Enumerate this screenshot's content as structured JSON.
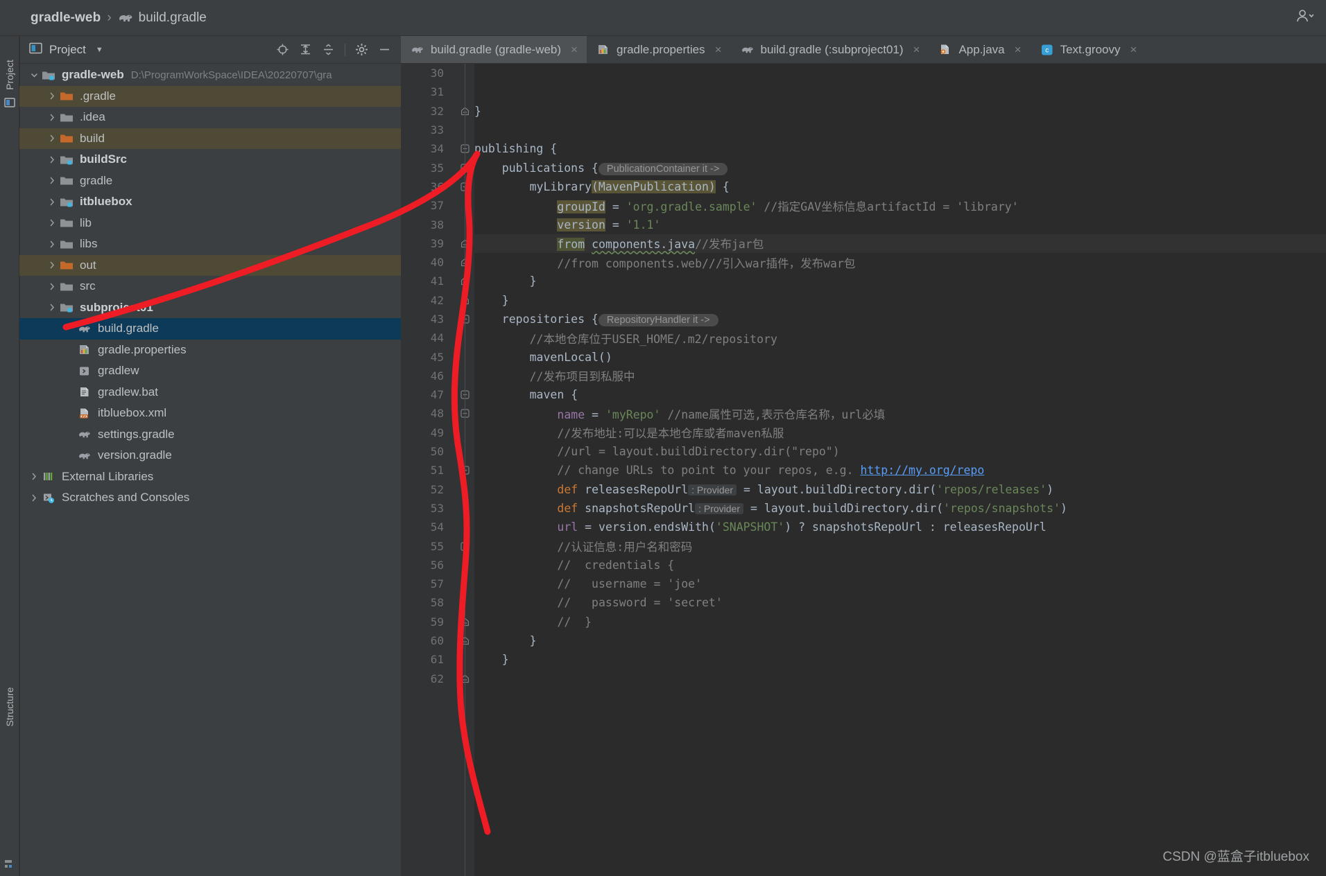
{
  "window": {
    "breadcrumb_project": "gradle-web",
    "breadcrumb_separator": "›",
    "breadcrumb_file": "build.gradle",
    "accent_selection": "#0d3a58",
    "accent_highlight": "#4f4a36",
    "annotation_color": "#ee1c25"
  },
  "left_strip": {
    "top_label": "Project",
    "bottom_label": "Structure"
  },
  "project_panel": {
    "title": "Project",
    "caret": "▼",
    "tools": [
      {
        "name": "locate-icon",
        "label": "Select Opened File"
      },
      {
        "name": "expand-all-icon",
        "label": "Expand All"
      },
      {
        "name": "collapse-all-icon",
        "label": "Collapse All"
      },
      {
        "name": "gear-icon",
        "label": "Settings"
      },
      {
        "name": "minimize-icon",
        "label": "Hide"
      }
    ],
    "tree": [
      {
        "label": "gradle-web",
        "path": "D:\\ProgramWorkSpace\\IDEA\\20220707\\gra",
        "indent": 0,
        "arrow": "down",
        "icon": "module-folder",
        "bold": true,
        "state": "normal"
      },
      {
        "label": ".gradle",
        "path": "",
        "indent": 1,
        "arrow": "right",
        "icon": "folder-orange",
        "bold": false,
        "state": "excluded"
      },
      {
        "label": ".idea",
        "path": "",
        "indent": 1,
        "arrow": "right",
        "icon": "folder-grey",
        "bold": false,
        "state": "normal"
      },
      {
        "label": "build",
        "path": "",
        "indent": 1,
        "arrow": "right",
        "icon": "folder-orange",
        "bold": false,
        "state": "excluded"
      },
      {
        "label": "buildSrc",
        "path": "",
        "indent": 1,
        "arrow": "right",
        "icon": "module-folder",
        "bold": true,
        "state": "normal"
      },
      {
        "label": "gradle",
        "path": "",
        "indent": 1,
        "arrow": "right",
        "icon": "folder-grey",
        "bold": false,
        "state": "normal"
      },
      {
        "label": "itbluebox",
        "path": "",
        "indent": 1,
        "arrow": "right",
        "icon": "module-folder",
        "bold": true,
        "state": "normal"
      },
      {
        "label": "lib",
        "path": "",
        "indent": 1,
        "arrow": "right",
        "icon": "folder-grey",
        "bold": false,
        "state": "normal"
      },
      {
        "label": "libs",
        "path": "",
        "indent": 1,
        "arrow": "right",
        "icon": "folder-grey",
        "bold": false,
        "state": "normal"
      },
      {
        "label": "out",
        "path": "",
        "indent": 1,
        "arrow": "right",
        "icon": "folder-orange",
        "bold": false,
        "state": "excluded"
      },
      {
        "label": "src",
        "path": "",
        "indent": 1,
        "arrow": "right",
        "icon": "folder-grey",
        "bold": false,
        "state": "normal"
      },
      {
        "label": "subproject01",
        "path": "",
        "indent": 1,
        "arrow": "right",
        "icon": "module-folder",
        "bold": true,
        "state": "normal"
      },
      {
        "label": "build.gradle",
        "path": "",
        "indent": 2,
        "arrow": "none",
        "icon": "gradle-file",
        "bold": false,
        "state": "selected"
      },
      {
        "label": "gradle.properties",
        "path": "",
        "indent": 2,
        "arrow": "none",
        "icon": "properties-file",
        "bold": false,
        "state": "normal"
      },
      {
        "label": "gradlew",
        "path": "",
        "indent": 2,
        "arrow": "none",
        "icon": "script-file",
        "bold": false,
        "state": "normal"
      },
      {
        "label": "gradlew.bat",
        "path": "",
        "indent": 2,
        "arrow": "none",
        "icon": "bat-file",
        "bold": false,
        "state": "normal"
      },
      {
        "label": "itbluebox.xml",
        "path": "",
        "indent": 2,
        "arrow": "none",
        "icon": "xml-file",
        "bold": false,
        "state": "normal"
      },
      {
        "label": "settings.gradle",
        "path": "",
        "indent": 2,
        "arrow": "none",
        "icon": "gradle-file",
        "bold": false,
        "state": "normal"
      },
      {
        "label": "version.gradle",
        "path": "",
        "indent": 2,
        "arrow": "none",
        "icon": "gradle-file",
        "bold": false,
        "state": "normal"
      },
      {
        "label": "External Libraries",
        "path": "",
        "indent": 0,
        "arrow": "right",
        "icon": "libraries",
        "bold": false,
        "state": "normal"
      },
      {
        "label": "Scratches and Consoles",
        "path": "",
        "indent": 0,
        "arrow": "right",
        "icon": "scratches",
        "bold": false,
        "state": "normal"
      }
    ]
  },
  "editor": {
    "tabs": [
      {
        "label": "build.gradle (gradle-web)",
        "icon": "gradle-file",
        "active": true,
        "close": "×"
      },
      {
        "label": "gradle.properties",
        "icon": "properties-file",
        "active": false,
        "close": "×"
      },
      {
        "label": "build.gradle (:subproject01)",
        "icon": "gradle-file",
        "active": false,
        "close": "×"
      },
      {
        "label": "App.java",
        "icon": "java-file",
        "active": false,
        "close": "×"
      },
      {
        "label": "Text.groovy",
        "icon": "groovy-file",
        "active": false,
        "close": "×"
      }
    ],
    "first_line_number": 30,
    "current_line": 39,
    "lines": [
      {
        "n": 30,
        "fold": "",
        "tokens": []
      },
      {
        "n": 31,
        "fold": "",
        "tokens": []
      },
      {
        "n": 32,
        "fold": "end",
        "tokens": [
          {
            "t": "}",
            "c": "brace",
            "indent": 0
          }
        ]
      },
      {
        "n": 33,
        "fold": "",
        "tokens": []
      },
      {
        "n": 34,
        "fold": "start",
        "tokens": [
          {
            "t": "publishing {",
            "c": "plain",
            "indent": 0
          }
        ]
      },
      {
        "n": 35,
        "fold": "start",
        "tokens": [
          {
            "t": "publications {",
            "c": "plain",
            "indent": 4
          },
          {
            "t": "PublicationContainer it ->",
            "c": "hint"
          }
        ]
      },
      {
        "n": 36,
        "fold": "start",
        "tokens": [
          {
            "t": "myLibrary",
            "c": "plain",
            "indent": 8
          },
          {
            "t": "(MavenPublication)",
            "c": "hlbox"
          },
          {
            "t": " {",
            "c": "plain"
          }
        ]
      },
      {
        "n": 37,
        "fold": "",
        "tokens": [
          {
            "t": "groupId",
            "c": "hlbox",
            "indent": 12
          },
          {
            "t": " = ",
            "c": "plain"
          },
          {
            "t": "'org.gradle.sample'",
            "c": "str"
          },
          {
            "t": " //指定GAV坐标信息artifactId = 'library'",
            "c": "cmt"
          }
        ]
      },
      {
        "n": 38,
        "fold": "",
        "tokens": [
          {
            "t": "version",
            "c": "hlbox",
            "indent": 12
          },
          {
            "t": " = ",
            "c": "plain"
          },
          {
            "t": "'1.1'",
            "c": "str"
          }
        ]
      },
      {
        "n": 39,
        "fold": "end",
        "current": true,
        "tokens": [
          {
            "t": "from",
            "c": "hlbox2",
            "indent": 12
          },
          {
            "t": " ",
            "c": "plain"
          },
          {
            "t": "components.java",
            "c": "squig"
          },
          {
            "t": "//发布jar包",
            "c": "cmt"
          }
        ]
      },
      {
        "n": 40,
        "fold": "end",
        "tokens": [
          {
            "t": "//from components.web///引入war插件，发布war包",
            "c": "cmt",
            "indent": 12
          }
        ]
      },
      {
        "n": 41,
        "fold": "end",
        "tokens": [
          {
            "t": "}",
            "c": "brace",
            "indent": 8
          }
        ]
      },
      {
        "n": 42,
        "fold": "end",
        "tokens": [
          {
            "t": "}",
            "c": "brace",
            "indent": 4
          }
        ]
      },
      {
        "n": 43,
        "fold": "start",
        "tokens": [
          {
            "t": "repositories {",
            "c": "plain",
            "indent": 4
          },
          {
            "t": "RepositoryHandler it ->",
            "c": "hint"
          }
        ]
      },
      {
        "n": 44,
        "fold": "",
        "tokens": [
          {
            "t": "//本地仓库位于USER_HOME/.m2/repository",
            "c": "cmt",
            "indent": 8
          }
        ]
      },
      {
        "n": 45,
        "fold": "",
        "tokens": [
          {
            "t": "mavenLocal()",
            "c": "plain",
            "indent": 8
          }
        ]
      },
      {
        "n": 46,
        "fold": "",
        "tokens": [
          {
            "t": "//发布项目到私服中",
            "c": "cmt",
            "indent": 8
          }
        ]
      },
      {
        "n": 47,
        "fold": "start",
        "tokens": [
          {
            "t": "maven {",
            "c": "plain",
            "indent": 8
          }
        ]
      },
      {
        "n": 48,
        "fold": "start",
        "tokens": [
          {
            "t": "name",
            "c": "prop",
            "indent": 12
          },
          {
            "t": " = ",
            "c": "plain"
          },
          {
            "t": "'myRepo'",
            "c": "str"
          },
          {
            "t": " //name属性可选,表示仓库名称，url必填",
            "c": "cmt"
          }
        ]
      },
      {
        "n": 49,
        "fold": "",
        "tokens": [
          {
            "t": "//发布地址:可以是本地仓库或者maven私服",
            "c": "cmt",
            "indent": 12
          }
        ]
      },
      {
        "n": 50,
        "fold": "",
        "tokens": [
          {
            "t": "//url = layout.buildDirectory.dir(\"repo\")",
            "c": "cmt",
            "indent": 12
          }
        ]
      },
      {
        "n": 51,
        "fold": "start",
        "tokens": [
          {
            "t": "// change URLs to point to your repos, e.g. ",
            "c": "cmt",
            "indent": 12
          },
          {
            "t": "http://my.org/repo",
            "c": "link"
          }
        ]
      },
      {
        "n": 52,
        "fold": "",
        "tokens": [
          {
            "t": "def",
            "c": "kw",
            "indent": 12
          },
          {
            "t": " releasesRepoUrl",
            "c": "plain"
          },
          {
            "t": ": Provider<Directory>",
            "c": "ptype"
          },
          {
            "t": " = layout.buildDirectory.dir(",
            "c": "plain"
          },
          {
            "t": "'repos/releases'",
            "c": "str"
          },
          {
            "t": ")",
            "c": "plain"
          }
        ]
      },
      {
        "n": 53,
        "fold": "",
        "tokens": [
          {
            "t": "def",
            "c": "kw",
            "indent": 12
          },
          {
            "t": " snapshotsRepoUrl",
            "c": "plain"
          },
          {
            "t": ": Provider<Directory>",
            "c": "ptype"
          },
          {
            "t": " = layout.buildDirectory.dir(",
            "c": "plain"
          },
          {
            "t": "'repos/snapshots'",
            "c": "str"
          },
          {
            "t": ")",
            "c": "plain"
          }
        ]
      },
      {
        "n": 54,
        "fold": "",
        "tokens": [
          {
            "t": "url",
            "c": "prop",
            "indent": 12
          },
          {
            "t": " = version.endsWith(",
            "c": "plain"
          },
          {
            "t": "'SNAPSHOT'",
            "c": "str"
          },
          {
            "t": ") ? snapshotsRepoUrl : releasesRepoUrl",
            "c": "plain"
          }
        ]
      },
      {
        "n": 55,
        "fold": "start",
        "tokens": [
          {
            "t": "//认证信息:用户名和密码",
            "c": "cmt",
            "indent": 12
          }
        ]
      },
      {
        "n": 56,
        "fold": "",
        "tokens": [
          {
            "t": "//  credentials {",
            "c": "cmt",
            "indent": 12
          }
        ]
      },
      {
        "n": 57,
        "fold": "",
        "tokens": [
          {
            "t": "//   username = 'joe'",
            "c": "cmt",
            "indent": 12
          }
        ]
      },
      {
        "n": 58,
        "fold": "",
        "tokens": [
          {
            "t": "//   password = 'secret'",
            "c": "cmt",
            "indent": 12
          }
        ]
      },
      {
        "n": 59,
        "fold": "end",
        "tokens": [
          {
            "t": "//  }",
            "c": "cmt",
            "indent": 12
          }
        ]
      },
      {
        "n": 60,
        "fold": "end",
        "tokens": [
          {
            "t": "}",
            "c": "brace",
            "indent": 8
          }
        ]
      },
      {
        "n": 61,
        "fold": "",
        "tokens": [
          {
            "t": "}",
            "c": "brace",
            "indent": 4
          }
        ]
      },
      {
        "n": 62,
        "fold": "end",
        "tokens": [
          {
            "t": "",
            "c": "brace",
            "indent": 0
          }
        ]
      }
    ]
  },
  "watermark": "CSDN @蓝盒子itbluebox"
}
